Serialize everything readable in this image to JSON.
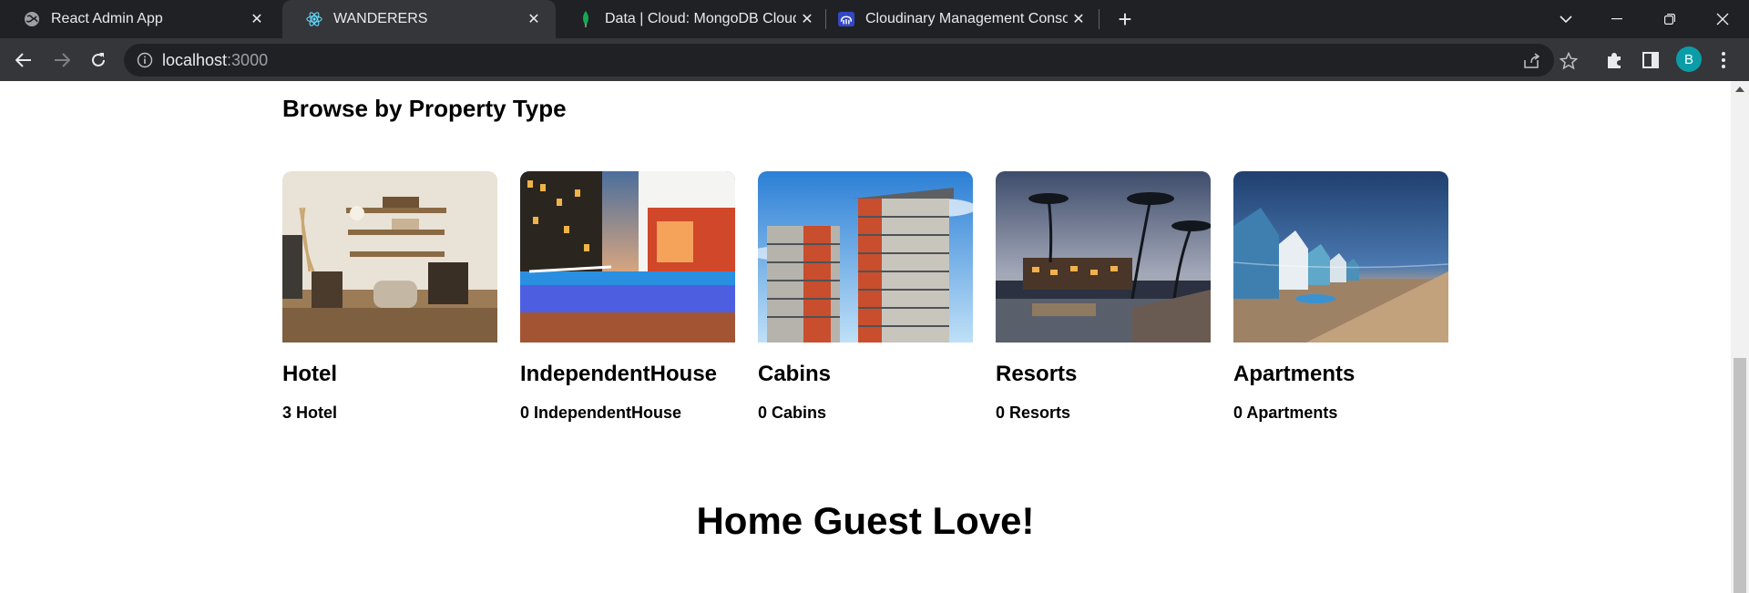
{
  "browser": {
    "tabs": [
      {
        "title": "React Admin App",
        "icon": "globe-icon",
        "active": false
      },
      {
        "title": "WANDERERS",
        "icon": "react-logo-icon",
        "active": true
      },
      {
        "title": "Data | Cloud: MongoDB Cloud",
        "icon": "mongodb-leaf-icon",
        "active": false
      },
      {
        "title": "Cloudinary Management Console",
        "icon": "cloudinary-icon",
        "active": false
      }
    ],
    "url_host": "localhost",
    "url_port": ":3000",
    "profile_initial": "B"
  },
  "page": {
    "section_title": "Browse by Property Type",
    "property_types": [
      {
        "name": "Hotel",
        "count_label": "3 Hotel"
      },
      {
        "name": "IndependentHouse",
        "count_label": "0 IndependentHouse"
      },
      {
        "name": "Cabins",
        "count_label": "0 Cabins"
      },
      {
        "name": "Resorts",
        "count_label": "0 Resorts"
      },
      {
        "name": "Apartments",
        "count_label": "0 Apartments"
      }
    ],
    "hero_title": "Home Guest Love!"
  },
  "colors": {
    "tabstrip_bg": "#202124",
    "toolbar_bg": "#35363a",
    "profile_bg": "#0b9da7"
  }
}
